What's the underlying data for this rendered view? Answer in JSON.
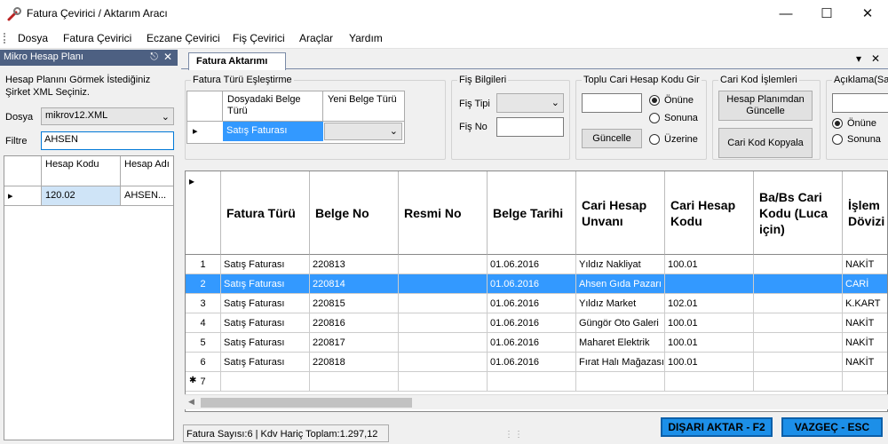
{
  "window": {
    "title": "Fatura Çevirici / Aktarım Aracı"
  },
  "menu": [
    "Dosya",
    "Fatura Çevirici",
    "Eczane Çevirici",
    "Fiş Çevirici",
    "Araçlar",
    "Yardım"
  ],
  "left_panel": {
    "title": "Mikro Hesap Planı",
    "description": "Hesap Planını Görmek İstediğiniz Şirket XML Seçiniz.",
    "file_label": "Dosya",
    "file_value": "mikrov12.XML",
    "filter_label": "Filtre",
    "filter_value": "AHSEN",
    "grid_headers": [
      "Hesap Kodu",
      "Hesap Adı"
    ],
    "grid_rows": [
      [
        "120.02",
        "AHSEN..."
      ]
    ]
  },
  "tab": {
    "label": "Fatura Aktarımı"
  },
  "mapping": {
    "group_title": "Fatura Türü Eşleştirme",
    "headers": [
      "Dosyadaki Belge Türü",
      "Yeni Belge Türü"
    ],
    "row_value": "Satış Faturası",
    "row_new": ""
  },
  "fis": {
    "group_title": "Fiş Bilgileri",
    "type_label": "Fiş Tipi",
    "no_label": "Fiş No",
    "type_value": "",
    "no_value": ""
  },
  "toplu": {
    "group_title": "Toplu Cari Hesap Kodu Gir",
    "input_value": "",
    "update_button": "Güncelle",
    "radios": [
      "Önüne",
      "Sonuna",
      "Üzerine"
    ],
    "selected": 0
  },
  "cari": {
    "group_title": "Cari Kod İşlemleri",
    "button1": "Hesap Planımdan Güncelle",
    "button2": "Cari Kod Kopyala"
  },
  "aciklama": {
    "group_title": "Açıklama(Sat",
    "input_value": "",
    "radios": [
      "Önüne",
      "Sonuna"
    ],
    "selected": 0
  },
  "grid": {
    "headers": [
      "Fatura Türü",
      "Belge No",
      "Resmi No",
      "Belge Tarihi",
      "Cari Hesap Unvanı",
      "Cari Hesap Kodu",
      "Ba/Bs Cari Kodu (Luca için)",
      "İşlem Dövizi"
    ],
    "rows": [
      {
        "n": "1",
        "cells": [
          "Satış Faturası",
          "220813",
          "",
          "01.06.2016",
          "Yıldız Nakliyat",
          "100.01",
          "",
          "NAKİT"
        ]
      },
      {
        "n": "2",
        "cells": [
          "Satış Faturası",
          "220814",
          "",
          "01.06.2016",
          "Ahsen Gıda Pazarı",
          "",
          "",
          "CARİ"
        ]
      },
      {
        "n": "3",
        "cells": [
          "Satış Faturası",
          "220815",
          "",
          "01.06.2016",
          "Yıldız Market",
          "102.01",
          "",
          "K.KART"
        ]
      },
      {
        "n": "4",
        "cells": [
          "Satış Faturası",
          "220816",
          "",
          "01.06.2016",
          "Güngör Oto Galeri",
          "100.01",
          "",
          "NAKİT"
        ]
      },
      {
        "n": "5",
        "cells": [
          "Satış Faturası",
          "220817",
          "",
          "01.06.2016",
          "Maharet Elektrik",
          "100.01",
          "",
          "NAKİT"
        ]
      },
      {
        "n": "6",
        "cells": [
          "Satış Faturası",
          "220818",
          "",
          "01.06.2016",
          "Fırat Halı Mağazası",
          "100.01",
          "",
          "NAKİT"
        ]
      }
    ],
    "new_row": "7",
    "selected_row": 1
  },
  "status": {
    "text": "Fatura Sayısı:6 | Kdv Hariç Toplam:1.297,12"
  },
  "buttons": {
    "export": "DIŞARI AKTAR - F2",
    "cancel": "VAZGEÇ - ESC"
  },
  "colors": {
    "selection": "#3399ff",
    "panel_header": "#4d6082",
    "action": "#1c8fe8"
  }
}
